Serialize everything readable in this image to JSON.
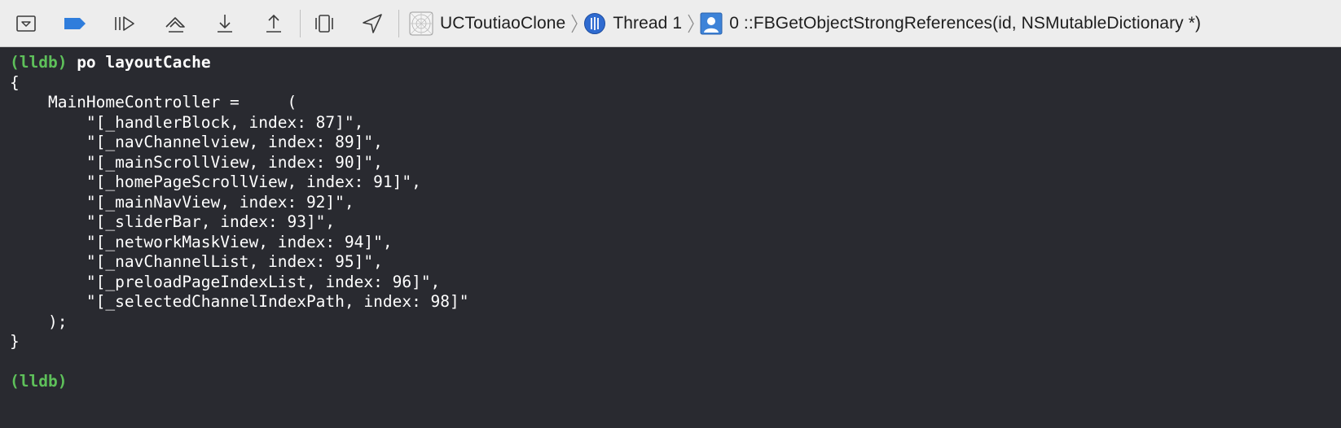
{
  "toolbar": {
    "icons": [
      "hide-debug-area-icon",
      "breakpoints-toggle-icon",
      "continue-execution-icon",
      "step-over-icon",
      "step-into-icon",
      "step-out-icon",
      "debug-view-hierarchy-icon",
      "simulate-location-icon"
    ],
    "accent_color": "#2f7ddc",
    "breadcrumbs": [
      {
        "label": "UCToutiaoClone",
        "icon": "app-target-icon"
      },
      {
        "label": "Thread 1",
        "icon": "thread-icon"
      },
      {
        "label": "0 ::FBGetObjectStrongReferences(id, NSMutableDictionary *)",
        "icon": "stack-frame-icon"
      }
    ]
  },
  "console": {
    "prompt": "(lldb)",
    "command": " po layoutCache",
    "output_lines": [
      "{",
      "    MainHomeController =     (",
      "        \"[_handlerBlock, index: 87]\",",
      "        \"[_navChannelview, index: 89]\",",
      "        \"[_mainScrollView, index: 90]\",",
      "        \"[_homePageScrollView, index: 91]\",",
      "        \"[_mainNavView, index: 92]\",",
      "        \"[_sliderBar, index: 93]\",",
      "        \"[_networkMaskView, index: 94]\",",
      "        \"[_navChannelList, index: 95]\",",
      "        \"[_preloadPageIndexList, index: 96]\",",
      "        \"[_selectedChannelIndexPath, index: 98]\"",
      "    );",
      "}"
    ],
    "final_prompt": "(lldb)",
    "prompt_color": "#5ec05a"
  }
}
